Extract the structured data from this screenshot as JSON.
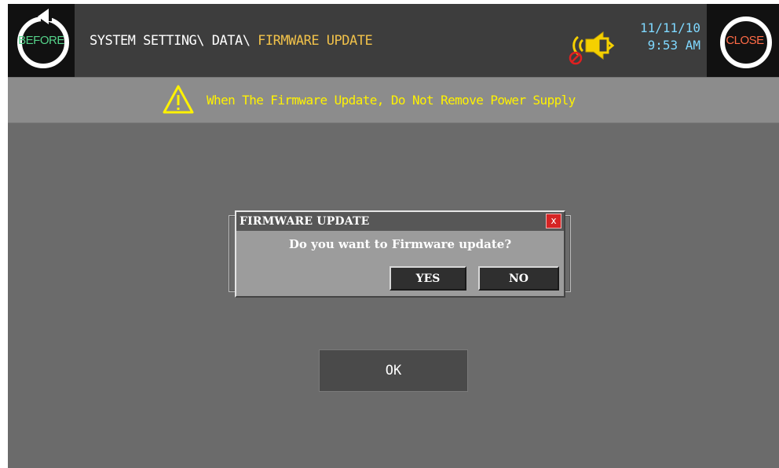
{
  "header": {
    "before_label": "BEFORE",
    "close_label": "CLOSE",
    "breadcrumb_prefix": "SYSTEM SETTING\\ DATA\\ ",
    "breadcrumb_current": "FIRMWARE UPDATE",
    "date": "11/11/10",
    "time": "9:53 AM",
    "icons": [
      "before-icon",
      "close-icon",
      "speaker-icon",
      "mute-indicator-icon"
    ]
  },
  "warning": {
    "text": "When The Firmware Update, Do Not Remove Power Supply",
    "icon": "warning-icon"
  },
  "dialog": {
    "title": "FIRMWARE UPDATE",
    "close_glyph": "x",
    "message": "Do you want to Firmware update?",
    "yes_label": "YES",
    "no_label": "NO"
  },
  "ok_label": "OK",
  "colors": {
    "screen_bg": "#6b6b6b",
    "header_bg": "#3d3d3d",
    "warning_text": "#fff200",
    "breadcrumb_current": "#f0c14a",
    "datetime": "#7fd8ff",
    "before_label": "#55d38a",
    "close_label": "#ff6b47",
    "dialog_close": "#d62424"
  }
}
